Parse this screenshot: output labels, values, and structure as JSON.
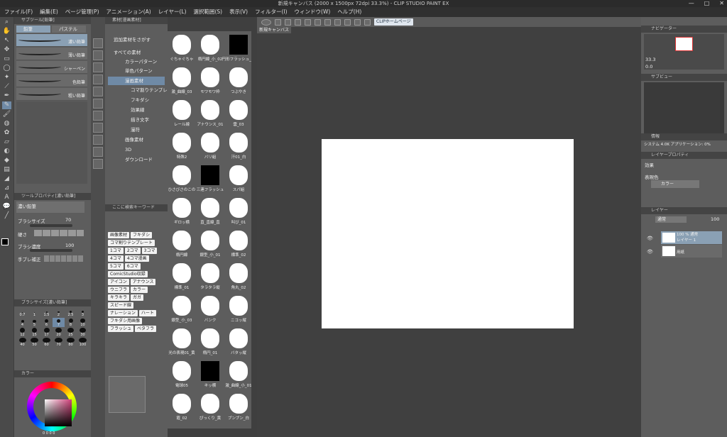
{
  "window": {
    "title": "新規キャンバス (2000 x 1500px 72dpi 33.3%) - CLIP STUDIO PAINT EX",
    "controls": [
      "—",
      "□",
      "✕"
    ]
  },
  "menu": [
    "ファイル(F)",
    "編集(E)",
    "ページ管理(P)",
    "アニメーション(A)",
    "レイヤー(L)",
    "選択範囲(S)",
    "表示(V)",
    "フィルター(I)",
    "ウィンドウ(W)",
    "ヘルプ(H)"
  ],
  "command_bar": {
    "home_label": "CLIPホームページ"
  },
  "tools": {
    "icons": [
      "zoom-icon",
      "hand-icon",
      "operation-icon",
      "move-icon",
      "select-icon",
      "lasso-icon",
      "wand-icon",
      "eyedropper-icon",
      "pen-icon",
      "pencil-icon",
      "brush-icon",
      "airbrush-icon",
      "decoration-icon",
      "eraser-icon",
      "blend-icon",
      "fill-icon",
      "gradient-icon",
      "figure-icon",
      "ruler-icon",
      "text-icon",
      "balloon-icon",
      "line-icon"
    ]
  },
  "subtool": {
    "header": "サブツール[鉛筆]",
    "tabs": [
      "鉛筆",
      "パステル"
    ],
    "brushes": [
      "濃い鉛筆",
      "薄い鉛筆",
      "シャーペン",
      "色鉛筆",
      "粗い鉛筆"
    ]
  },
  "toolprop": {
    "header": "ツールプロパティ[濃い鉛筆]",
    "name": "濃い鉛筆",
    "rows": [
      {
        "label": "ブラシサイズ",
        "value": "70"
      },
      {
        "label": "硬さ",
        "value": ""
      },
      {
        "label": "ブラシ濃度",
        "value": "100"
      },
      {
        "label": "手ブレ補正",
        "value": ""
      }
    ]
  },
  "brushsize": {
    "header": "ブラシサイズ[濃い鉛筆]",
    "sizes": [
      "0.7",
      "1",
      "1.5",
      "2",
      "2.5",
      "3",
      "4",
      "5",
      "6",
      "7",
      "8",
      "10",
      "12",
      "15",
      "17",
      "20",
      "25",
      "30",
      "40",
      "50",
      "60",
      "70",
      "80",
      "100"
    ],
    "selected": "7"
  },
  "colorp": {
    "header": "カラー",
    "values": "0 0 0 0"
  },
  "materials": {
    "header": "素材[漫画素材]",
    "add": "追加素材をさがす",
    "tree": [
      "すべての素材",
      "カラーパターン",
      "単色パターン",
      "漫画素材",
      "コマ割りテンプレート",
      "フキダシ",
      "効果線",
      "描き文字",
      "漫符",
      "画像素材",
      "3D",
      "ダウンロード"
    ],
    "search_header": "ここに検索キーワード",
    "tags": [
      "画像素材",
      "フキダシ",
      "コマ割りテンプレート",
      "1コマ",
      "2コマ",
      "3コマ",
      "4コマ",
      "4コマ漫画",
      "5コマ",
      "6コマ",
      "ComicStudio収録",
      "アイコン",
      "アナウンス",
      "ウニフラ",
      "カラー",
      "キラキラ",
      "ガガ",
      "スピード線",
      "ナレーション",
      "ハート",
      "フキダシ用画像",
      "フラッシュ",
      "ベタフラ"
    ],
    "items": [
      "ぐちゃぐちゃ",
      "楕円線_小_02",
      "円形フラッシュ_黒",
      "激_曲線_03",
      "モワモワ枠",
      "つぶやき",
      "レール線",
      "アナウンス_01",
      "雲_03",
      "特殊2",
      "バリ組",
      "汗01_白",
      "ひさびさのこの",
      "三連フラッシュ",
      "スパ組",
      "ギロッ横",
      "直_直線_直",
      "叫び_01",
      "楕円線",
      "銀型_小_01",
      "標準_02",
      "標準_01",
      "タラタラ縦",
      "角丸_02",
      "銀型_小_03",
      "バンク",
      "ニコッ縦",
      "光の表現01_黄",
      "楕円_01",
      "バタッ縦",
      "電球05",
      "キッ横",
      "激_曲線_小_01",
      "霞_02",
      "ぴっくり_黄",
      "ブンブン_白"
    ]
  },
  "canvas": {
    "tab": "新規キャンバス"
  },
  "right": {
    "navigator_header": "ナビゲーター",
    "zoom": "33.3",
    "rotate": "0.0",
    "subview_header": "サブビュー",
    "info_header": "情報",
    "info_text": "システム 4.0K アプリケーション: 0%",
    "layerprop_header": "レイヤープロパティ",
    "effect_label": "効果",
    "color_label": "表現色",
    "color_value": "カラー",
    "layers_header": "レイヤー",
    "blend_mode": "通常",
    "opacity": "100",
    "layers": [
      {
        "name": "100 % 通常",
        "sub": "レイヤー 1"
      },
      {
        "name": "用紙",
        "sub": ""
      }
    ]
  }
}
